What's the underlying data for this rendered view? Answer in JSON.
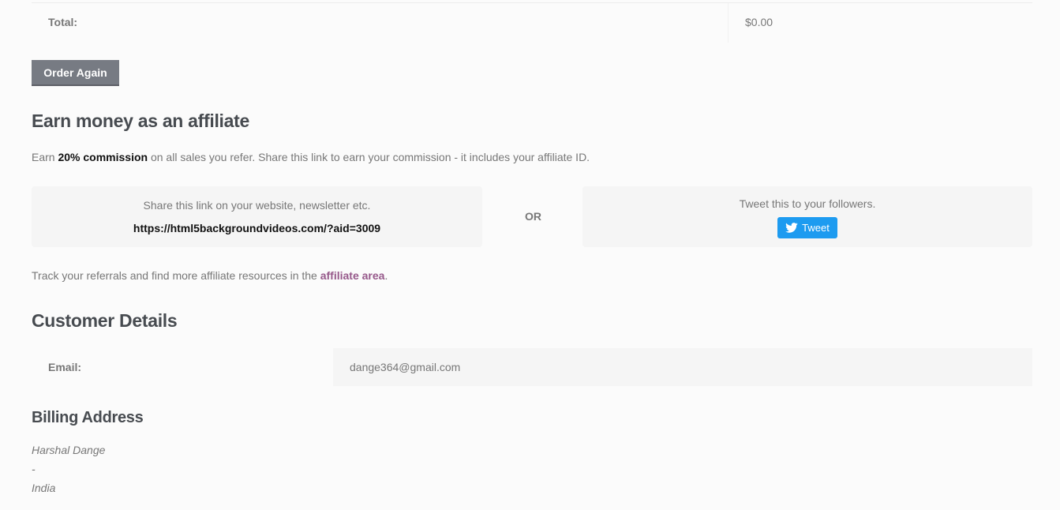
{
  "order_summary": {
    "total_label": "Total:",
    "total_value": "$0.00",
    "order_again_label": "Order Again"
  },
  "affiliate": {
    "heading": "Earn money as an affiliate",
    "intro_prefix": "Earn ",
    "intro_commission": "20% commission",
    "intro_suffix": " on all sales you refer. Share this link to earn your commission - it includes your affiliate ID.",
    "share_caption": "Share this link on your website, newsletter etc.",
    "share_link": "https://html5backgroundvideos.com/?aid=3009",
    "or_label": "OR",
    "tweet_caption": "Tweet this to your followers.",
    "tweet_button_label": "Tweet",
    "track_prefix": "Track your referrals and find more affiliate resources in the ",
    "track_link": "affiliate area",
    "track_suffix": "."
  },
  "customer": {
    "heading": "Customer Details",
    "email_label": "Email:",
    "email_value": "dange364@gmail.com"
  },
  "billing": {
    "heading": "Billing Address",
    "lines": [
      "Harshal Dange",
      "-",
      "India"
    ]
  },
  "colors": {
    "button_gray": "#777b83",
    "tweet_blue": "#1d9bf0",
    "link_purple": "#96588a",
    "heading_dark": "#474b50",
    "panel_bg": "#f5f5f5"
  },
  "icons": {
    "tweet": "twitter-bird-icon"
  }
}
